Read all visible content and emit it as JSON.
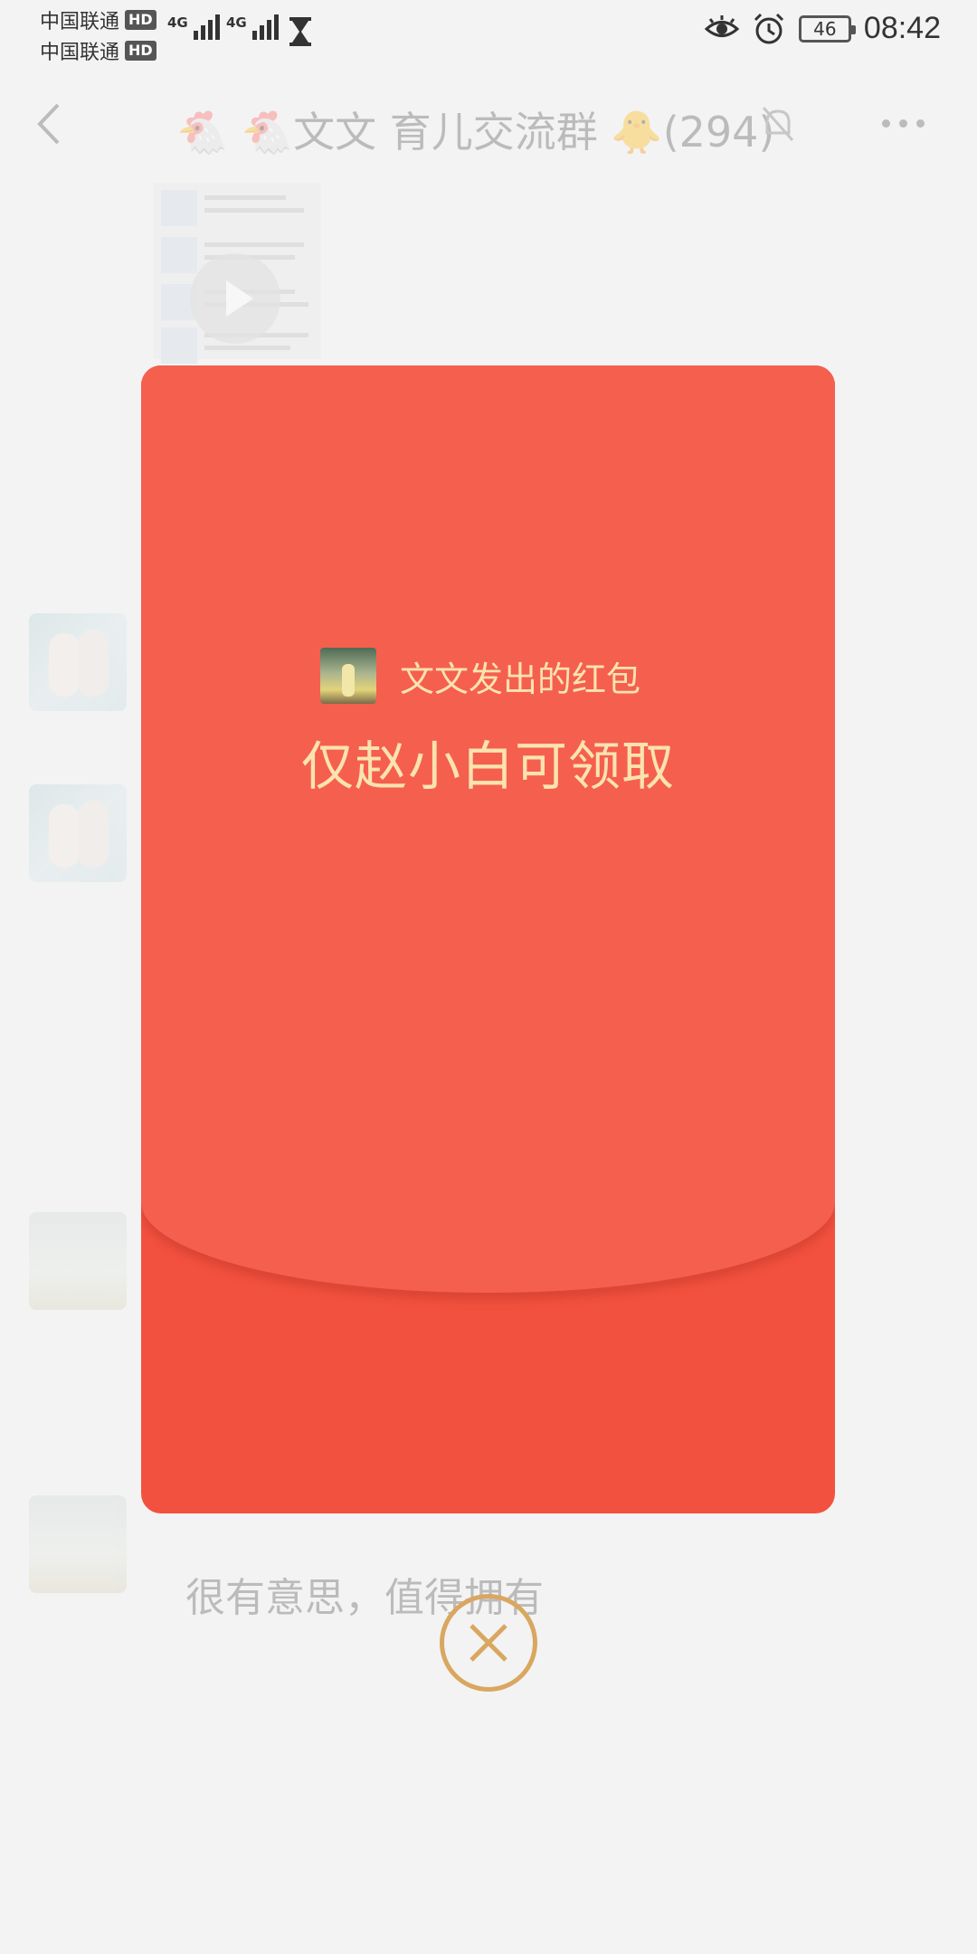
{
  "status_bar": {
    "carrier1": "中国联通",
    "carrier2": "中国联通",
    "hd_badge": "HD",
    "network1": "4G",
    "network2": "4G",
    "battery": "46",
    "time": "08:42"
  },
  "chat": {
    "title": "🐔 🐔文文 育儿交流群 🐥(294)",
    "last_message": "很有意思，值得拥有"
  },
  "red_packet": {
    "sender_text": "文文发出的红包",
    "title": "仅赵小白可领取"
  },
  "colors": {
    "envelope_top": "#f55f4e",
    "envelope_bottom": "#f3513f",
    "envelope_text": "#fbe3b0",
    "close_ring": "#d9a760"
  }
}
